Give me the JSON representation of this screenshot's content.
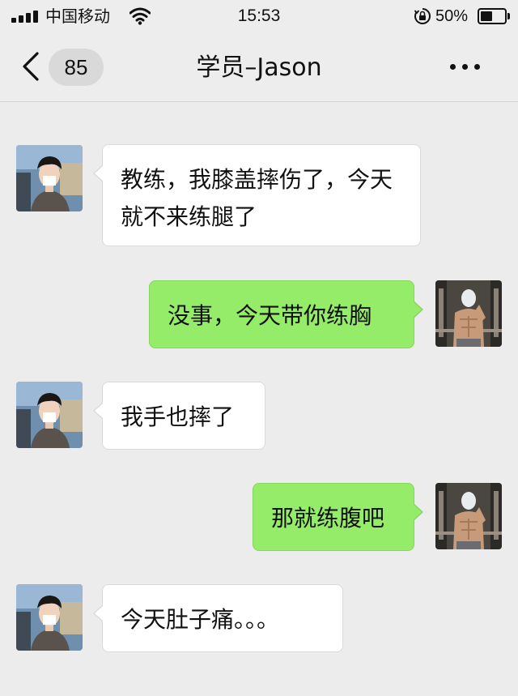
{
  "status_bar": {
    "carrier": "中国移动",
    "time": "15:53",
    "battery_percent": "50%",
    "battery_level": 0.5,
    "icons": [
      "signal-icon",
      "wifi-icon",
      "orientation-lock-icon",
      "battery-icon"
    ]
  },
  "nav": {
    "back_icon": "chevron-left-icon",
    "unread_count": "85",
    "title": "学员–Jason",
    "more_icon": "more-dots-icon"
  },
  "colors": {
    "outgoing_bubble": "#95ec69",
    "incoming_bubble": "#ffffff",
    "background": "#ececec"
  },
  "messages": [
    {
      "sender": "Jason",
      "direction": "incoming",
      "text": "教练，我膝盖摔伤了，今天就不来练腿了"
    },
    {
      "sender": "coach",
      "direction": "outgoing",
      "text": "没事，今天带你练胸"
    },
    {
      "sender": "Jason",
      "direction": "incoming",
      "text": "我手也摔了"
    },
    {
      "sender": "coach",
      "direction": "outgoing",
      "text": "那就练腹吧"
    },
    {
      "sender": "Jason",
      "direction": "incoming",
      "text": "今天肚子痛。。。"
    }
  ]
}
